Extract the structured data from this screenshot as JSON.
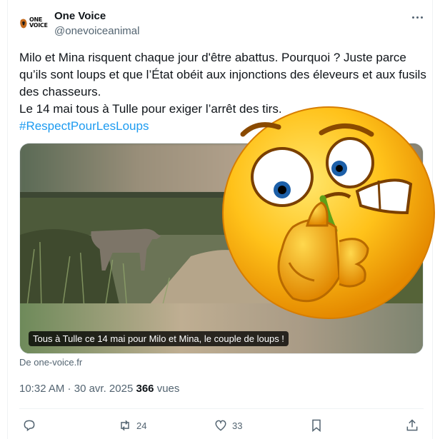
{
  "author": {
    "logo_text_line1": "ONE",
    "logo_text_line2": "VOICE",
    "display_name": "One Voice",
    "handle": "@onevoiceanimal"
  },
  "menu": {
    "more_icon": "more-horizontal-icon"
  },
  "tweet": {
    "text_main": "Milo et Mina risquent chaque jour d'être abattus. Pourquoi ? Juste parce qu’ils sont loups et que l’État obéit aux injonctions des éleveurs et aux fusils des chasseurs.\nLe 14 mai tous à Tulle pour exiger l’arrêt des tirs.",
    "hashtag": "#RespectPourLesLoups"
  },
  "media": {
    "caption": "Tous à Tulle ce 14 mai pour Milo et Mina, le couple de loups !",
    "source": "De one-voice.fr"
  },
  "overlay": {
    "emoji_icon": "nose-picking-emoji"
  },
  "meta": {
    "time": "10:32 AM",
    "separator": " · ",
    "date": "30 avr. 2025",
    "views_count": "366",
    "views_label": "vues"
  },
  "actions": {
    "reply": {
      "icon": "reply-icon",
      "count": ""
    },
    "retweet": {
      "icon": "retweet-icon",
      "count": "24"
    },
    "like": {
      "icon": "heart-icon",
      "count": "33"
    },
    "bookmark": {
      "icon": "bookmark-icon",
      "count": ""
    },
    "share": {
      "icon": "share-icon",
      "count": ""
    }
  },
  "colors": {
    "link": "#1d9bf0",
    "secondary_text": "#536471",
    "primary_text": "#0f1419"
  }
}
